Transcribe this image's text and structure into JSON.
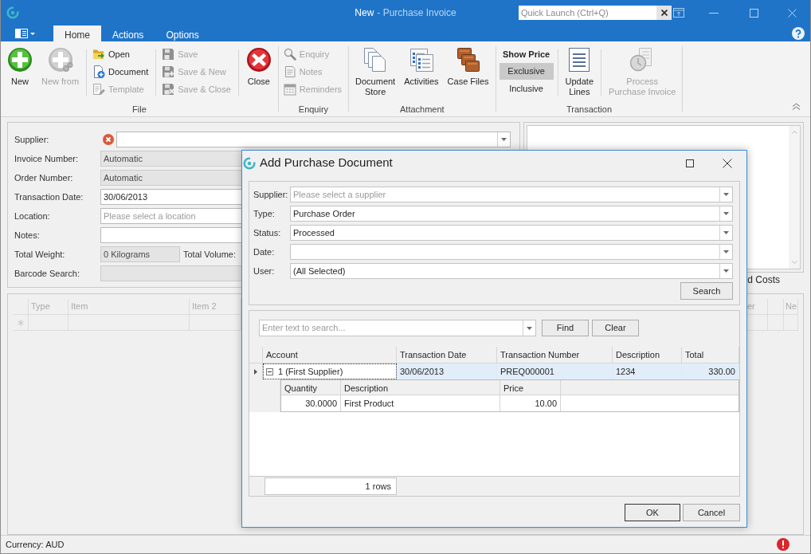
{
  "window": {
    "document": "New",
    "title": "- Purchase Invoice",
    "quick_launch": {
      "placeholder": "Quick Launch (Ctrl+Q)"
    }
  },
  "ribbon": {
    "tabs": [
      {
        "label": "Home",
        "selected": true
      },
      {
        "label": "Actions",
        "selected": false
      },
      {
        "label": "Options",
        "selected": false
      }
    ],
    "groups": [
      {
        "label": "File",
        "sections": [
          {
            "kind": "large",
            "items": [
              {
                "label": "New",
                "disabled": false
              },
              {
                "label": "New from",
                "disabled": true
              }
            ]
          },
          {
            "kind": "small",
            "items": [
              {
                "label": "Open",
                "disabled": false
              },
              {
                "label": "Document",
                "disabled": false
              },
              {
                "label": "Template",
                "disabled": true
              }
            ]
          },
          {
            "kind": "small",
            "items": [
              {
                "label": "Save",
                "disabled": true
              },
              {
                "label": "Save & New",
                "disabled": true
              },
              {
                "label": "Save & Close",
                "disabled": true
              }
            ]
          },
          {
            "kind": "large",
            "items": [
              {
                "label": "Close",
                "disabled": false
              }
            ]
          }
        ]
      },
      {
        "label": "Enquiry",
        "sections": [
          {
            "kind": "small",
            "items": [
              {
                "label": "Enquiry",
                "disabled": true
              },
              {
                "label": "Notes",
                "disabled": true
              },
              {
                "label": "Reminders",
                "disabled": true
              }
            ]
          }
        ]
      },
      {
        "label": "Attachment",
        "sections": [
          {
            "kind": "large",
            "items": [
              {
                "label": "Document\nStore",
                "disabled": false
              },
              {
                "label": "Activities",
                "disabled": false
              },
              {
                "label": "Case Files",
                "disabled": false
              }
            ]
          }
        ]
      },
      {
        "label": "Transaction",
        "sections": [
          {
            "kind": "toggle",
            "title": "Show Price",
            "options": [
              {
                "label": "Exclusive",
                "selected": true
              },
              {
                "label": "Inclusive",
                "selected": false
              }
            ]
          },
          {
            "kind": "large",
            "items": [
              {
                "label": "Update\nLines",
                "disabled": false
              }
            ]
          },
          {
            "kind": "large",
            "items": [
              {
                "label": "Process\nPurchase Invoice",
                "disabled": true
              }
            ]
          }
        ]
      }
    ]
  },
  "invoice_form": {
    "fields": [
      {
        "label": "Supplier:",
        "kind": "combo",
        "error": true,
        "disabled": false
      },
      {
        "label": "Invoice Number:",
        "kind": "text",
        "value": "Automatic",
        "disabled": true
      },
      {
        "label": "Order Number:",
        "kind": "text",
        "value": "Automatic",
        "disabled": true
      },
      {
        "label": "Transaction Date:",
        "kind": "text",
        "value": "30/06/2013",
        "disabled": false
      },
      {
        "label": "Location:",
        "kind": "text",
        "placeholder": "Please select a location",
        "disabled": false
      },
      {
        "label": "Notes:",
        "kind": "text",
        "disabled": false
      },
      {
        "label": "Total Weight:",
        "kind": "measure",
        "value": "0 Kilograms",
        "aside_label": "Total Volume:",
        "disabled": true
      },
      {
        "label": "Barcode Search:",
        "kind": "text",
        "disabled": true
      }
    ]
  },
  "right_panel": {
    "caption": "d Costs"
  },
  "lines_grid": {
    "disabled": true,
    "columns": [
      "Type",
      "Item",
      "Item 2",
      "er",
      "Ne"
    ]
  },
  "status_bar": {
    "text": "Currency: AUD",
    "error": true
  },
  "dialog": {
    "title": "Add Purchase Document",
    "filters": [
      {
        "label": "Supplier:",
        "placeholder": "Please select a supplier"
      },
      {
        "label": "Type:",
        "value": "Purchase Order"
      },
      {
        "label": "Status:",
        "value": "Processed"
      },
      {
        "label": "Date:"
      },
      {
        "label": "User:",
        "value": "(All Selected)"
      }
    ],
    "search_button": "Search",
    "find_panel": {
      "placeholder": "Enter text to search...",
      "find_button": "Find",
      "clear_button": "Clear"
    },
    "grid": {
      "columns": [
        "Account",
        "Transaction Date",
        "Transaction Number",
        "Description",
        "Total"
      ],
      "rows": [
        {
          "selected": true,
          "expanded": true,
          "cells": [
            "1 (First Supplier)",
            "30/06/2013",
            "PREQ000001",
            "1234",
            "330.00"
          ],
          "detail": {
            "columns": [
              "Quantity",
              "Description",
              "Price"
            ],
            "rows": [
              [
                "30.0000",
                "First Product",
                "10.00"
              ]
            ]
          }
        }
      ]
    },
    "row_count": "1 rows",
    "buttons": [
      {
        "label": "OK",
        "default": true
      },
      {
        "label": "Cancel",
        "default": false
      }
    ]
  }
}
